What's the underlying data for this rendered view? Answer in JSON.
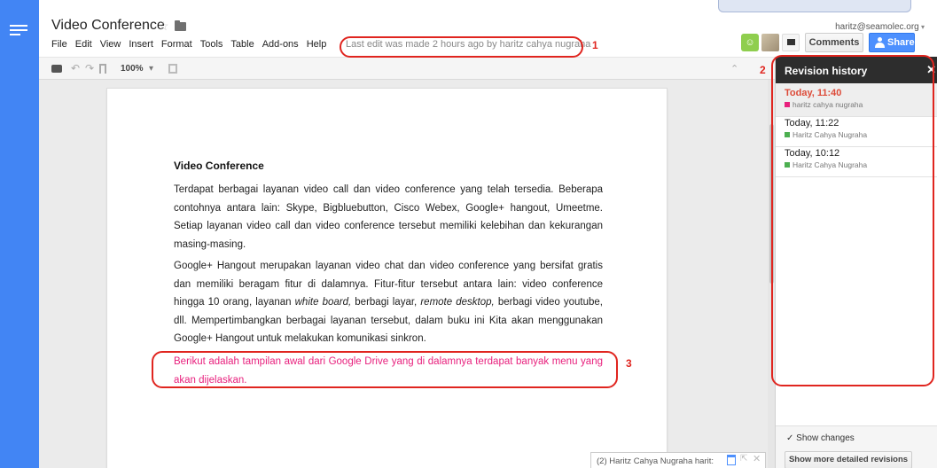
{
  "document": {
    "title": "Video Conference",
    "last_edit": "Last edit was made 2 hours ago by haritz cahya nugraha",
    "heading": "Video Conference",
    "paragraphs": [
      "Terdapat berbagai layanan video call dan video conference yang telah tersedia. Beberapa contohnya antara lain: Skype, Bigbluebutton, Cisco Webex, Google+ hangout, Umeetme. Setiap layanan video call dan video conference tersebut memiliki kelebihan dan kekurangan masing-masing.",
      {
        "before": "Google+ Hangout merupakan layanan video chat dan video conference yang bersifat gratis dan memiliki beragam fitur di dalamnya. Fitur-fitur tersebut antara lain: video conference hingga 10 orang, layanan ",
        "italic1": "white board,",
        "mid": " berbagi layar, ",
        "italic2": "remote desktop,",
        "after": " berbagi video youtube, dll. Mempertimbangkan berbagai layanan tersebut, dalam buku ini Kita akan menggunakan Google+ Hangout untuk melakukan komunikasi sinkron."
      },
      "Berikut adalah tampilan awal dari Google Drive yang di dalamnya terdapat banyak menu yang akan dijelaskan."
    ]
  },
  "menu": [
    "File",
    "Edit",
    "View",
    "Insert",
    "Format",
    "Tools",
    "Table",
    "Add-ons",
    "Help"
  ],
  "account": {
    "email": "haritz@seamolec.org"
  },
  "buttons": {
    "comments": "Comments",
    "share": "Share"
  },
  "toolbar": {
    "zoom": "100%"
  },
  "annotations": [
    "1",
    "2",
    "3"
  ],
  "revision_history": {
    "title": "Revision history",
    "items": [
      {
        "time": "Today, 11:40",
        "author": "haritz cahya nugraha",
        "color": "#e8207d",
        "selected": true
      },
      {
        "time": "Today, 11:22",
        "author": "Haritz Cahya Nugraha",
        "color": "#4caf50",
        "selected": false
      },
      {
        "time": "Today, 10:12",
        "author": "Haritz Cahya Nugraha",
        "color": "#4caf50",
        "selected": false
      }
    ],
    "show_changes": "Show changes",
    "detailed_button": "Show more detailed revisions"
  },
  "chat": {
    "label": "(2) Haritz Cahya Nugraha harit:"
  },
  "colors": {
    "brand": "#4285f4",
    "annotation": "#e0251f",
    "highlight_text": "#e8207d",
    "share": "#4d90fe"
  }
}
